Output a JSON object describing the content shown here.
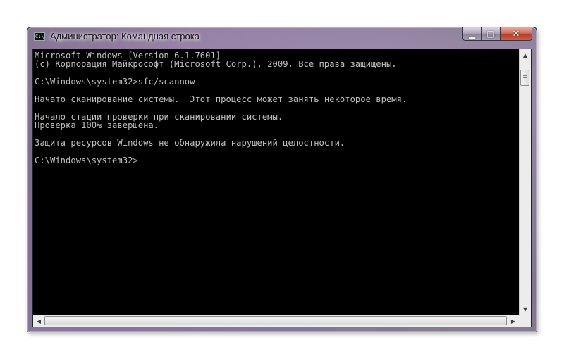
{
  "window": {
    "title": "Администратор: Командная строка",
    "icon": "cmd-icon",
    "icon_label": "C:\\"
  },
  "caption_buttons": {
    "minimize": "▁",
    "maximize": "□",
    "close": "✕"
  },
  "console": {
    "text_color": "#c0c0c0",
    "background": "#000000",
    "lines": [
      "Microsoft Windows [Version 6.1.7601]",
      "(c) Корпорация Майкрософт (Microsoft Corp.), 2009. Все права защищены.",
      "",
      "C:\\Windows\\system32>sfc/scannow",
      "",
      "Начато сканирование системы.  Этот процесс может занять некоторое время.",
      "",
      "Начало стадии проверки при сканировании системы.",
      "Проверка 100% завершена.",
      "",
      "Защита ресурсов Windows не обнаружила нарушений целостности.",
      "",
      "C:\\Windows\\system32>"
    ]
  },
  "scrollbars": {
    "up_arrow": "▲",
    "down_arrow": "▼",
    "left_arrow": "◀",
    "right_arrow": "▶"
  }
}
